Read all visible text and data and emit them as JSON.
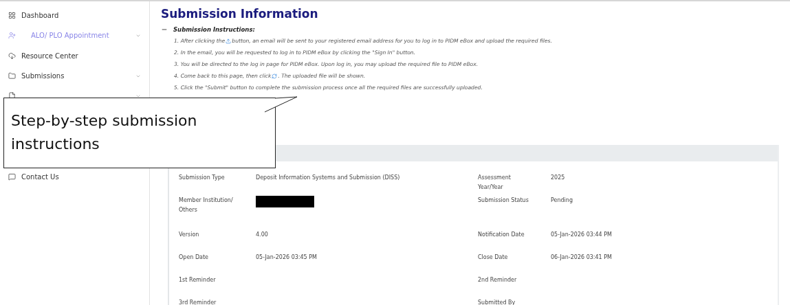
{
  "sidebar": {
    "items": [
      {
        "label": "Dashboard",
        "selected": false,
        "chevron": false
      },
      {
        "label": "ALO/ PLO Appointment",
        "selected": true,
        "chevron": true
      },
      {
        "label": "Resource Center",
        "selected": false,
        "chevron": false
      },
      {
        "label": "Submissions",
        "selected": false,
        "chevron": true
      },
      {
        "chevron": true
      },
      {
        "label": "Contact Us",
        "selected": false,
        "chevron": false
      }
    ]
  },
  "title": "Submission Information",
  "instructions": {
    "heading": "Submission Instructions:",
    "expanded": true,
    "steps": [
      {
        "before": "1. After clicking the ",
        "after": "button, an email will be sent to your registered email address for you to log in to PIDM eBox and upload the required files."
      },
      {
        "before": "2. In the email, you will be requested to log in to PIDM eBox by clicking the \"Sign In\" button."
      },
      {
        "before": "3. You will be directed to the log in page for PIDM eBox. Upon log in, you may upload the required file to PIDM eBox."
      },
      {
        "before": "4. Come back to this page, then click ",
        "after": ". The uploaded file will be shown."
      },
      {
        "before": "5. Click the \"Submit\" button to complete the submission process once all the required files are successfully uploaded."
      }
    ]
  },
  "details": [
    [
      {
        "label": "Submission Type",
        "value": "Deposit Information Systems and Submission (DISS)"
      },
      {
        "label": "Assessment Year/Year",
        "value": "2025"
      }
    ],
    [
      {
        "label": "Member Institution/ Others",
        "kind": "redacted"
      },
      {
        "label": "Submission Status",
        "value": "Pending"
      }
    ],
    [
      {
        "label": "Version",
        "value": "4.00"
      },
      {
        "label": "Notification Date",
        "value": "05-Jan-2026 03:44 PM"
      }
    ],
    [
      {
        "label": "Open Date",
        "value": "05-Jan-2026 03:45 PM"
      },
      {
        "label": "Close Date",
        "value": "06-Jan-2026 03:41 PM"
      }
    ],
    [
      {
        "label": "1st Reminder"
      },
      {
        "label": "2nd Reminder"
      }
    ],
    [
      {
        "label": "3rd Reminder"
      },
      {
        "label": "Submitted By"
      }
    ]
  ],
  "callout": {
    "text": "Step-by-step submission instructions"
  }
}
